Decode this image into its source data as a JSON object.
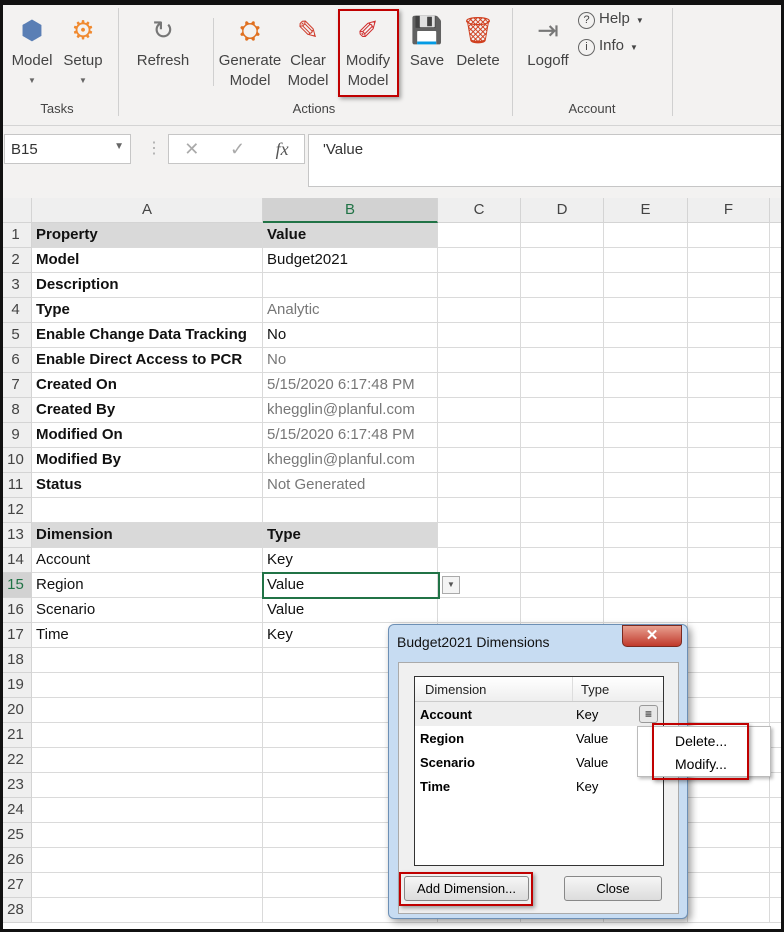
{
  "ribbon": {
    "buttons": [
      {
        "label": "Model",
        "icon": "cubes-icon",
        "dropdown": true
      },
      {
        "label": "Setup",
        "icon": "gear-icon",
        "dropdown": true
      },
      {
        "label": "Refresh",
        "icon": "refresh-icon"
      },
      {
        "label": "Generate\nModel",
        "icon": "generate-model-icon"
      },
      {
        "label": "Clear\nModel",
        "icon": "clear-model-icon"
      },
      {
        "label": "Modify\nModel",
        "icon": "modify-model-icon",
        "highlighted": true
      },
      {
        "label": "Save",
        "icon": "save-icon"
      },
      {
        "label": "Delete",
        "icon": "trash-icon"
      },
      {
        "label": "Logoff",
        "icon": "logoff-icon"
      }
    ],
    "help": "Help",
    "info": "Info",
    "groups": [
      "Tasks",
      "Actions",
      "Account"
    ]
  },
  "formula_bar": {
    "name_box": "B15",
    "formula": "'Value",
    "fx": "fx"
  },
  "sheet": {
    "columns": [
      "A",
      "B",
      "C",
      "D",
      "E",
      "F"
    ],
    "active_cell": "B15",
    "rows": [
      {
        "n": 1,
        "a": "Property",
        "b": "Value",
        "style": "header"
      },
      {
        "n": 2,
        "a": "Model",
        "b": "Budget2021"
      },
      {
        "n": 3,
        "a": "Description",
        "b": ""
      },
      {
        "n": 4,
        "a": "Type",
        "b": "Analytic",
        "gray": true
      },
      {
        "n": 5,
        "a": "Enable Change Data Tracking",
        "b": "No"
      },
      {
        "n": 6,
        "a": "Enable Direct Access to PCR",
        "b": "No",
        "gray": true
      },
      {
        "n": 7,
        "a": "Created On",
        "b": "5/15/2020 6:17:48 PM",
        "gray": true
      },
      {
        "n": 8,
        "a": "Created By",
        "b": "khegglin@planful.com",
        "gray": true
      },
      {
        "n": 9,
        "a": "Modified On",
        "b": "5/15/2020 6:17:48 PM",
        "gray": true
      },
      {
        "n": 10,
        "a": "Modified By",
        "b": "khegglin@planful.com",
        "gray": true
      },
      {
        "n": 11,
        "a": "Status",
        "b": "Not Generated",
        "gray": true
      },
      {
        "n": 12,
        "a": "",
        "b": ""
      },
      {
        "n": 13,
        "a": "Dimension",
        "b": "Type",
        "style": "header"
      },
      {
        "n": 14,
        "a": "Account",
        "b": "Key",
        "plain": true
      },
      {
        "n": 15,
        "a": "Region",
        "b": "Value",
        "plain": true
      },
      {
        "n": 16,
        "a": "Scenario",
        "b": "Value",
        "plain": true
      },
      {
        "n": 17,
        "a": "Time",
        "b": "Key",
        "plain": true
      },
      {
        "n": 18
      },
      {
        "n": 19
      },
      {
        "n": 20
      },
      {
        "n": 21
      },
      {
        "n": 22
      },
      {
        "n": 23
      },
      {
        "n": 24
      },
      {
        "n": 25
      },
      {
        "n": 26
      },
      {
        "n": 27
      },
      {
        "n": 28
      }
    ]
  },
  "dialog": {
    "title": "Budget2021 Dimensions",
    "columns": [
      "Dimension",
      "Type"
    ],
    "rows": [
      {
        "dimension": "Account",
        "type": "Key"
      },
      {
        "dimension": "Region",
        "type": "Value"
      },
      {
        "dimension": "Scenario",
        "type": "Value"
      },
      {
        "dimension": "Time",
        "type": "Key"
      }
    ],
    "context_menu": [
      "Delete...",
      "Modify..."
    ],
    "add_button": "Add Dimension...",
    "close_button": "Close"
  },
  "colors": {
    "highlight": "#c00000",
    "active_cell": "#217346",
    "header_fill": "#d9d9d9"
  }
}
